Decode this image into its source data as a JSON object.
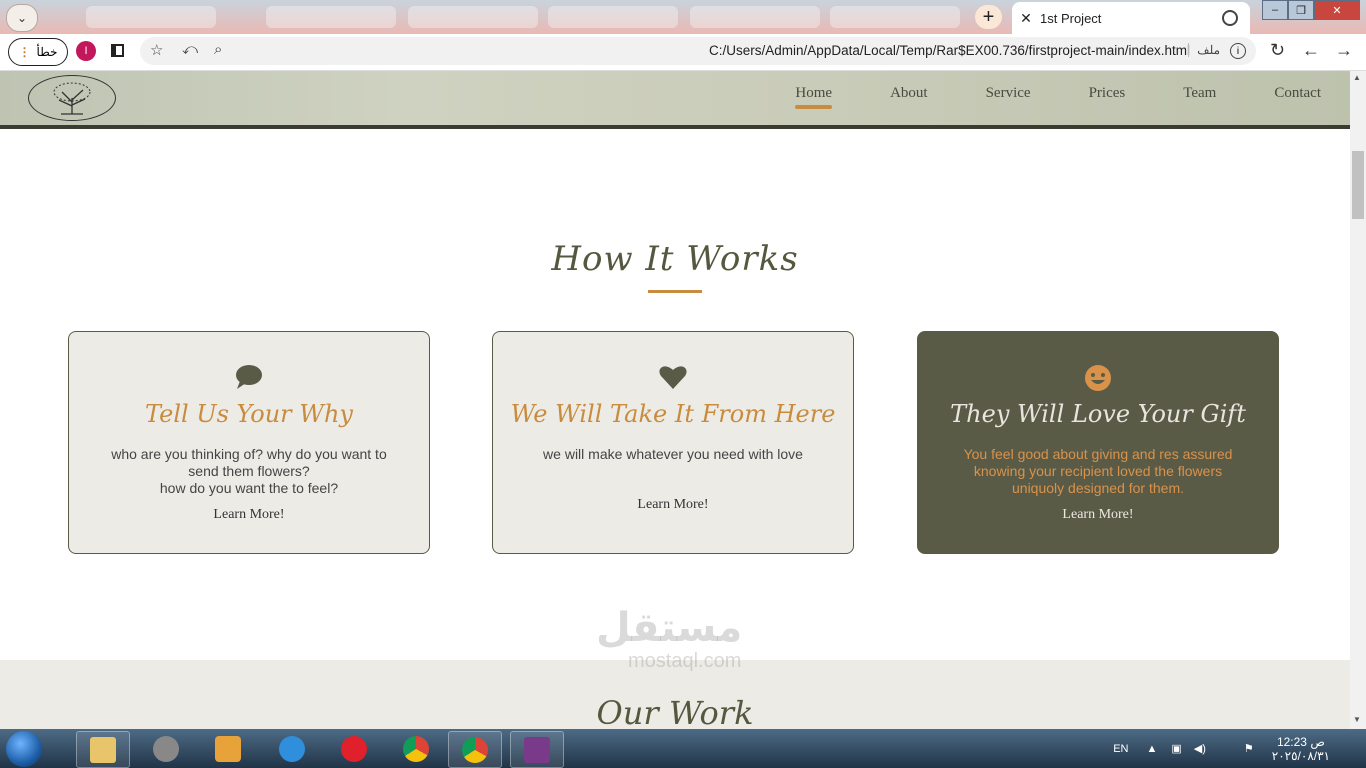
{
  "browser": {
    "active_tab_title": "1st Project",
    "address": "C:/Users/Admin/AppData/Local/Temp/Rar$EX00.736/firstproject-main/index.html",
    "error_pill_label": "خطأ",
    "profile_initial": "I",
    "file_label": "ملف",
    "colors": {
      "tab_strip": "#e9b9b4",
      "profile": "#c2185b"
    }
  },
  "site": {
    "nav": [
      "Home",
      "About",
      "Service",
      "Prices",
      "Team",
      "Contact"
    ],
    "active_nav": "Home",
    "section_title": "How It Works",
    "cards": [
      {
        "icon": "speech-bubble-icon",
        "title": "Tell Us Your Why",
        "lines": [
          "who are you thinking of? why do you want to send them flowers?",
          "how do you want the to feel?"
        ],
        "link": "Learn More!"
      },
      {
        "icon": "heart-icon",
        "title": "We Will Take It From Here",
        "lines": [
          "we will make whatever you need with love"
        ],
        "link": "Learn More!"
      },
      {
        "icon": "smiley-icon",
        "title": "They Will Love Your Gift",
        "lines": [
          "You feel good about giving and res assured knowing your recipient loved the flowers uniquoly designed for them."
        ],
        "link": "Learn More!"
      }
    ],
    "next_section_title": "Our Work",
    "colors": {
      "accent": "#c98c3e",
      "dark_card": "#5a5b47",
      "card_bg": "#edebe6"
    }
  },
  "watermark": {
    "text": "مستقل",
    "sub": "mostaql.com"
  },
  "taskbar": {
    "language": "EN",
    "time": "12:23 ص",
    "date": "٢٠٢٥/٠٨/٣١"
  }
}
